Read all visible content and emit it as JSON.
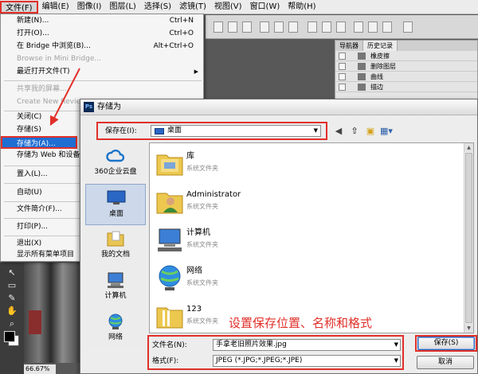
{
  "menubar": {
    "items": [
      "文件(F)",
      "编辑(E)",
      "图像(I)",
      "图层(L)",
      "选择(S)",
      "滤镜(T)",
      "视图(V)",
      "窗口(W)",
      "帮助(H)"
    ]
  },
  "file_menu": {
    "items": [
      {
        "label": "新建(N)...",
        "shortcut": "Ctrl+N"
      },
      {
        "label": "打开(O)...",
        "shortcut": "Ctrl+O"
      },
      {
        "label": "在 Bridge 中浏览(B)...",
        "shortcut": "Alt+Ctrl+O"
      },
      {
        "label": "Browse in Mini Bridge...",
        "shortcut": ""
      },
      {
        "label": "最近打开文件(T)",
        "shortcut": ""
      },
      {
        "label": "共享我的屏幕...",
        "shortcut": ""
      },
      {
        "label": "Create New Review...",
        "shortcut": ""
      },
      {
        "label": "关闭(C)",
        "shortcut": ""
      },
      {
        "label": "存储(S)",
        "shortcut": ""
      },
      {
        "label": "存储为(A)...",
        "shortcut": ""
      },
      {
        "label": "存储为 Web 和设备所",
        "shortcut": ""
      },
      {
        "label": "置入(L)...",
        "shortcut": ""
      },
      {
        "label": "自动(U)",
        "shortcut": ""
      },
      {
        "label": "文件简介(F)...",
        "shortcut": ""
      },
      {
        "label": "打印(P)...",
        "shortcut": ""
      },
      {
        "label": "退出(X)",
        "shortcut": ""
      },
      {
        "label": "显示所有菜单项目",
        "shortcut": ""
      }
    ]
  },
  "history_panel": {
    "tabs": [
      "导航器",
      "历史记录"
    ],
    "items": [
      "橡皮擦",
      "删除图层",
      "曲线",
      "描边"
    ]
  },
  "workspace": {
    "zoom": "66.67%"
  },
  "dialog": {
    "title": "存储为",
    "badge": "Ps",
    "save_in_label": "保存在(I):",
    "save_in_value": "桌面",
    "places": [
      "360企业云盘",
      "桌面",
      "我的文档",
      "计算机",
      "网络"
    ],
    "files": [
      {
        "name": "库",
        "type": "系统文件夹"
      },
      {
        "name": "Administrator",
        "type": "系统文件夹"
      },
      {
        "name": "计算机",
        "type": "系统文件夹"
      },
      {
        "name": "网络",
        "type": "系统文件夹"
      },
      {
        "name": "123",
        "type": "系统文件夹"
      }
    ],
    "annotation": "设置保存位置、名称和格式",
    "filename_label": "文件名(N):",
    "filename_value": "手拿老旧照片效果.jpg",
    "format_label": "格式(F):",
    "format_value": "JPEG (*.JPG;*.JPEG;*.JPE)",
    "save_button": "保存(S)",
    "cancel_button": "取消"
  },
  "colors": {
    "highlight": "#1f6ed2",
    "annotation_red": "#e1302a"
  }
}
